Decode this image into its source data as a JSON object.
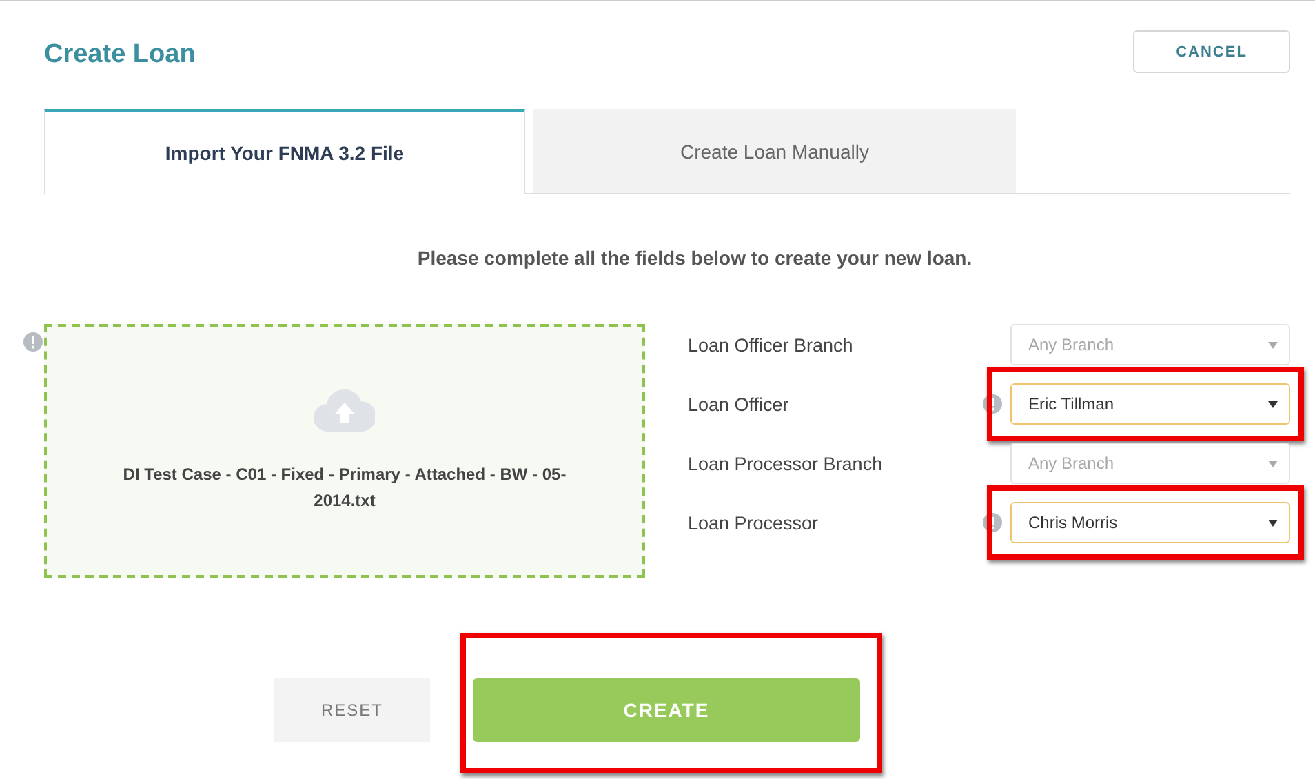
{
  "header": {
    "title": "Create Loan",
    "cancel_button": "CANCEL"
  },
  "tabs": [
    {
      "label": "Import Your FNMA 3.2 File",
      "selected": true
    },
    {
      "label": "Create Loan Manually",
      "selected": false
    }
  ],
  "instructions": "Please complete all the fields below to create your new loan.",
  "upload": {
    "file_name": "DI Test Case - C01 - Fixed - Primary - Attached - BW - 05-2014.txt",
    "warning": true
  },
  "fields": [
    {
      "label": "Loan Officer Branch",
      "value": "Any Branch",
      "disabled": true,
      "warning": false,
      "highlighted": false
    },
    {
      "label": "Loan Officer",
      "value": "Eric Tillman",
      "disabled": false,
      "warning": true,
      "highlighted": true
    },
    {
      "label": "Loan Processor Branch",
      "value": "Any Branch",
      "disabled": true,
      "warning": false,
      "highlighted": false
    },
    {
      "label": "Loan Processor",
      "value": "Chris Morris",
      "disabled": false,
      "warning": true,
      "highlighted": true
    }
  ],
  "actions": {
    "reset_button": "RESET",
    "create_button": "CREATE",
    "create_highlighted": true
  }
}
